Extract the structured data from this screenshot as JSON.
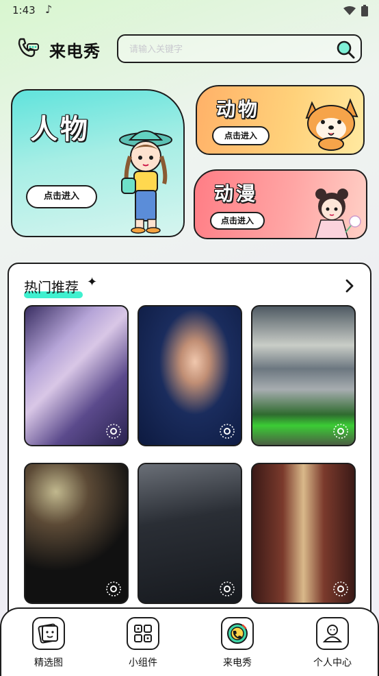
{
  "status_bar": {
    "time": "1:43"
  },
  "header": {
    "title": "来电秀",
    "search_placeholder": "请输入关键字"
  },
  "categories": [
    {
      "title": "人物",
      "button": "点击进入"
    },
    {
      "title": "动物",
      "button": "点击进入"
    },
    {
      "title": "动漫",
      "button": "点击进入"
    }
  ],
  "hot": {
    "title": "热门推荐",
    "thumbnails": [
      "thumb-1",
      "thumb-2",
      "thumb-3",
      "thumb-4",
      "thumb-5",
      "thumb-6"
    ]
  },
  "tabbar": {
    "items": [
      {
        "label": "精选图",
        "icon": "picture-icon"
      },
      {
        "label": "小组件",
        "icon": "widget-icon"
      },
      {
        "label": "来电秀",
        "icon": "phone-show-icon"
      },
      {
        "label": "个人中心",
        "icon": "user-icon"
      }
    ]
  },
  "colors": {
    "accent": "#3ff0cf",
    "renwu_bg": "#60e3dc",
    "dongwu_bg": "#ffb168",
    "dongman_bg": "#ff7d85"
  }
}
